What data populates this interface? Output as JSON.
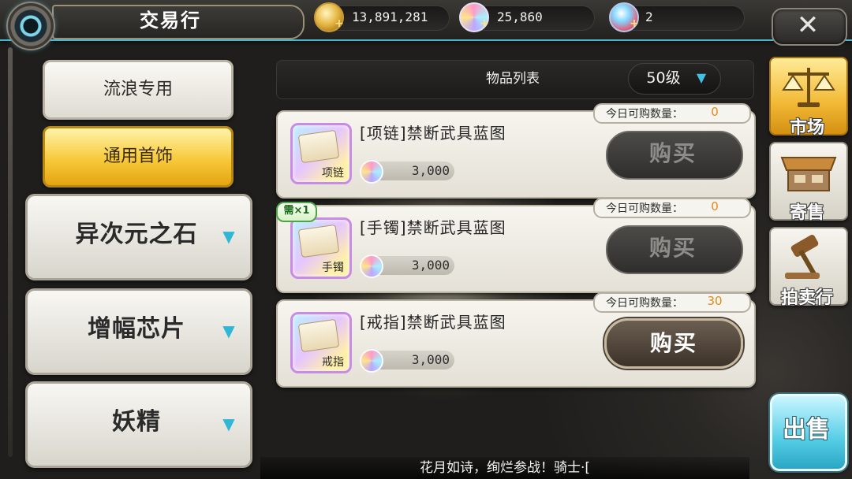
{
  "header": {
    "title": "交易行"
  },
  "currencies": [
    {
      "icon": "gold-coin-icon",
      "value": "13,891,281"
    },
    {
      "icon": "rainbow-coin-icon",
      "value": "25,860"
    },
    {
      "icon": "gem-icon",
      "value": "2"
    }
  ],
  "close_label": "✕",
  "categories": [
    {
      "label": "流浪专用",
      "active": false
    },
    {
      "label": "通用首饰",
      "active": true
    },
    {
      "label": "异次元之石",
      "expandable": true
    },
    {
      "label": "增幅芯片",
      "expandable": true
    },
    {
      "label": "妖精",
      "expandable": true
    }
  ],
  "list": {
    "header_label": "物品列表",
    "level_filter": "50级"
  },
  "items": [
    {
      "name": "[项链]禁断武具蓝图",
      "icon_tag": "项链",
      "price": "3,000",
      "quota_label": "今日可购数量：",
      "quota_value": "0",
      "buy_label": "购买",
      "buy_enabled": false,
      "badge": ""
    },
    {
      "name": "[手镯]禁断武具蓝图",
      "icon_tag": "手镯",
      "price": "3,000",
      "quota_label": "今日可购数量：",
      "quota_value": "0",
      "buy_label": "购买",
      "buy_enabled": false,
      "badge": "需×1"
    },
    {
      "name": "[戒指]禁断武具蓝图",
      "icon_tag": "戒指",
      "price": "3,000",
      "quota_label": "今日可购数量：",
      "quota_value": "30",
      "buy_label": "购买",
      "buy_enabled": true,
      "badge": ""
    }
  ],
  "nav": [
    {
      "label": "市场",
      "icon": "scales-icon",
      "active": true
    },
    {
      "label": "寄售",
      "icon": "stall-icon",
      "active": false
    },
    {
      "label": "拍卖行",
      "icon": "gavel-icon",
      "active": false
    }
  ],
  "sell_label": "出售",
  "ticker_text": "花月如诗，绚烂参战！骑士·["
}
